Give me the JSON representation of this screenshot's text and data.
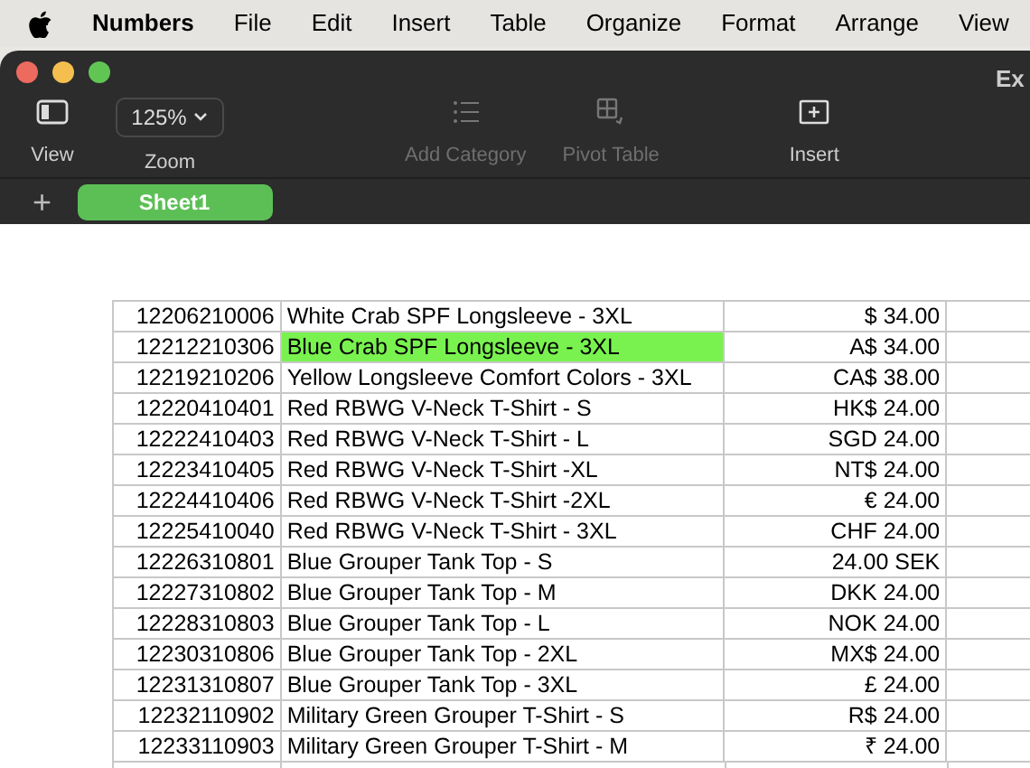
{
  "menu_bar": {
    "app": "Numbers",
    "items": [
      "File",
      "Edit",
      "Insert",
      "Table",
      "Organize",
      "Format",
      "Arrange",
      "View"
    ]
  },
  "window": {
    "title": "Ex"
  },
  "toolbar": [
    {
      "kind": "view",
      "label": "View",
      "disabled": false
    },
    {
      "kind": "zoom",
      "label": "Zoom",
      "value": "125%",
      "disabled": false
    },
    {
      "kind": "category",
      "label": "Add Category",
      "disabled": true
    },
    {
      "kind": "pivot",
      "label": "Pivot Table",
      "disabled": true
    },
    {
      "kind": "insert",
      "label": "Insert",
      "disabled": false
    }
  ],
  "sheets": {
    "add": "+",
    "tabs": [
      {
        "label": "Sheet1",
        "selected": true
      }
    ]
  },
  "table": {
    "rows": [
      {
        "id": "12206210006",
        "name": "White Crab SPF Longsleeve - 3XL",
        "price": "$ 34.00",
        "highlighted": false
      },
      {
        "id": "12212210306",
        "name": "Blue Crab SPF Longsleeve - 3XL",
        "price": "A$ 34.00",
        "highlighted": true
      },
      {
        "id": "12219210206",
        "name": "Yellow Longsleeve Comfort Colors - 3XL",
        "price": "CA$ 38.00",
        "highlighted": false
      },
      {
        "id": "12220410401",
        "name": "Red RBWG V-Neck T-Shirt - S",
        "price": "HK$ 24.00",
        "highlighted": false
      },
      {
        "id": "12222410403",
        "name": "Red RBWG V-Neck T-Shirt - L",
        "price": "SGD 24.00",
        "highlighted": false
      },
      {
        "id": "12223410405",
        "name": "Red RBWG V-Neck T-Shirt -XL",
        "price": "NT$ 24.00",
        "highlighted": false
      },
      {
        "id": "12224410406",
        "name": "Red RBWG V-Neck T-Shirt -2XL",
        "price": "€ 24.00",
        "highlighted": false
      },
      {
        "id": "12225410040",
        "name": "Red RBWG V-Neck T-Shirt - 3XL",
        "price": "CHF 24.00",
        "highlighted": false
      },
      {
        "id": "12226310801",
        "name": "Blue Grouper Tank Top - S",
        "price": "24.00 SEK",
        "highlighted": false
      },
      {
        "id": "12227310802",
        "name": "Blue Grouper Tank Top - M",
        "price": "DKK 24.00",
        "highlighted": false
      },
      {
        "id": "12228310803",
        "name": "Blue Grouper Tank Top - L",
        "price": "NOK 24.00",
        "highlighted": false
      },
      {
        "id": "12230310806",
        "name": "Blue Grouper Tank Top - 2XL",
        "price": "MX$ 24.00",
        "highlighted": false
      },
      {
        "id": "12231310807",
        "name": "Blue Grouper Tank Top - 3XL",
        "price": "£ 24.00",
        "highlighted": false
      },
      {
        "id": "12232110902",
        "name": "Military Green Grouper T-Shirt - S",
        "price": "R$ 24.00",
        "highlighted": false
      },
      {
        "id": "12233110903",
        "name": "Military Green Grouper T-Shirt - M",
        "price": "₹ 24.00",
        "highlighted": false
      }
    ]
  }
}
